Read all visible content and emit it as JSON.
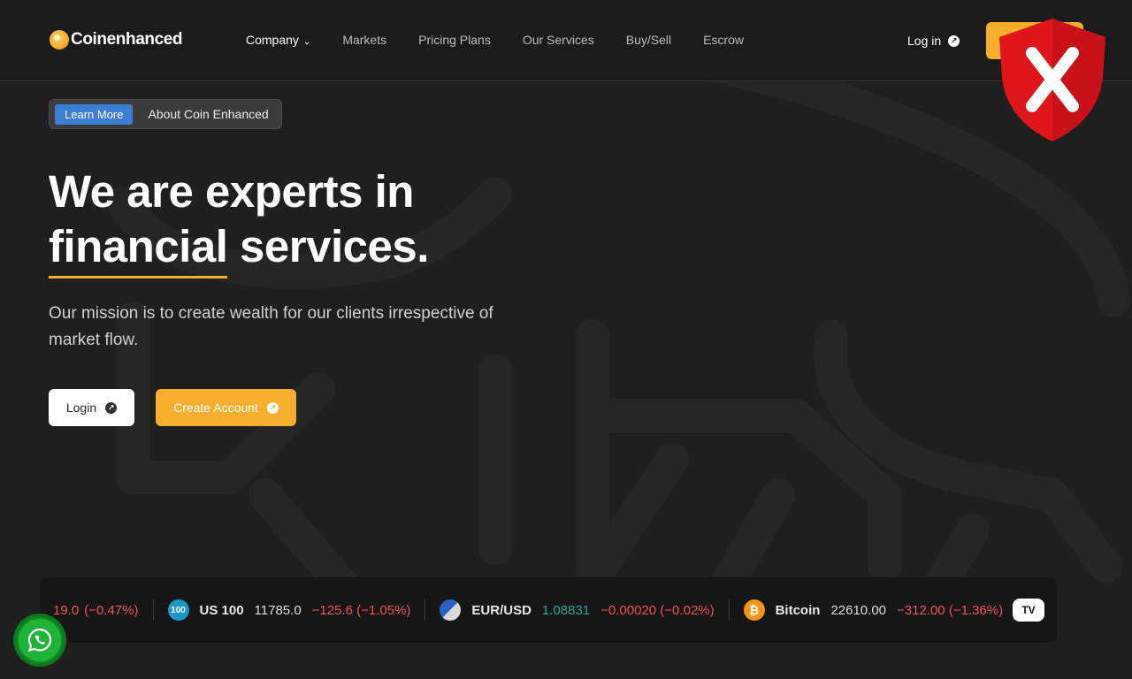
{
  "brand": {
    "name": "Coinenhanced"
  },
  "nav": {
    "items": [
      {
        "label": "Company",
        "has_dropdown": true
      },
      {
        "label": "Markets"
      },
      {
        "label": "Pricing Plans"
      },
      {
        "label": "Our Services"
      },
      {
        "label": "Buy/Sell"
      },
      {
        "label": "Escrow"
      }
    ],
    "login": "Log in"
  },
  "badge": {
    "pill": "Learn More",
    "text": "About Coin Enhanced"
  },
  "hero": {
    "line1": "We are experts in",
    "line2_highlight": "financial",
    "line2_rest": " services.",
    "mission": "Our mission is to create wealth for our clients irrespective of market flow."
  },
  "buttons": {
    "login": "Login",
    "create": "Create Account"
  },
  "ticker": {
    "partial": {
      "price": "19.0",
      "change": "(−0.47%)"
    },
    "items": [
      {
        "icon": "100",
        "name": "US 100",
        "price": "11785.0",
        "change": "−125.6 (−1.05%)",
        "direction": "down"
      },
      {
        "icon": "eur-usd-flag",
        "name": "EUR/USD",
        "price": "1.08831",
        "change": "−0.00020 (−0.02%)",
        "direction": "down"
      },
      {
        "icon": "₿",
        "name": "Bitcoin",
        "price": "22610.00",
        "change": "−312.00 (−1.36%)",
        "direction": "down"
      }
    ],
    "provider_logo": "TV"
  },
  "colors": {
    "accent": "#f6ae2d",
    "badge_blue": "#3d7fd6",
    "shield_red": "#e0161d",
    "up": "#26a69a",
    "down": "#ef5350",
    "whatsapp": "#1fb33a"
  },
  "icons": [
    "arrow-up-right-icon",
    "chevron-down-icon",
    "shield-x-icon",
    "whatsapp-icon",
    "bitcoin-icon",
    "us100-icon",
    "eur-usd-icon",
    "tradingview-logo"
  ]
}
